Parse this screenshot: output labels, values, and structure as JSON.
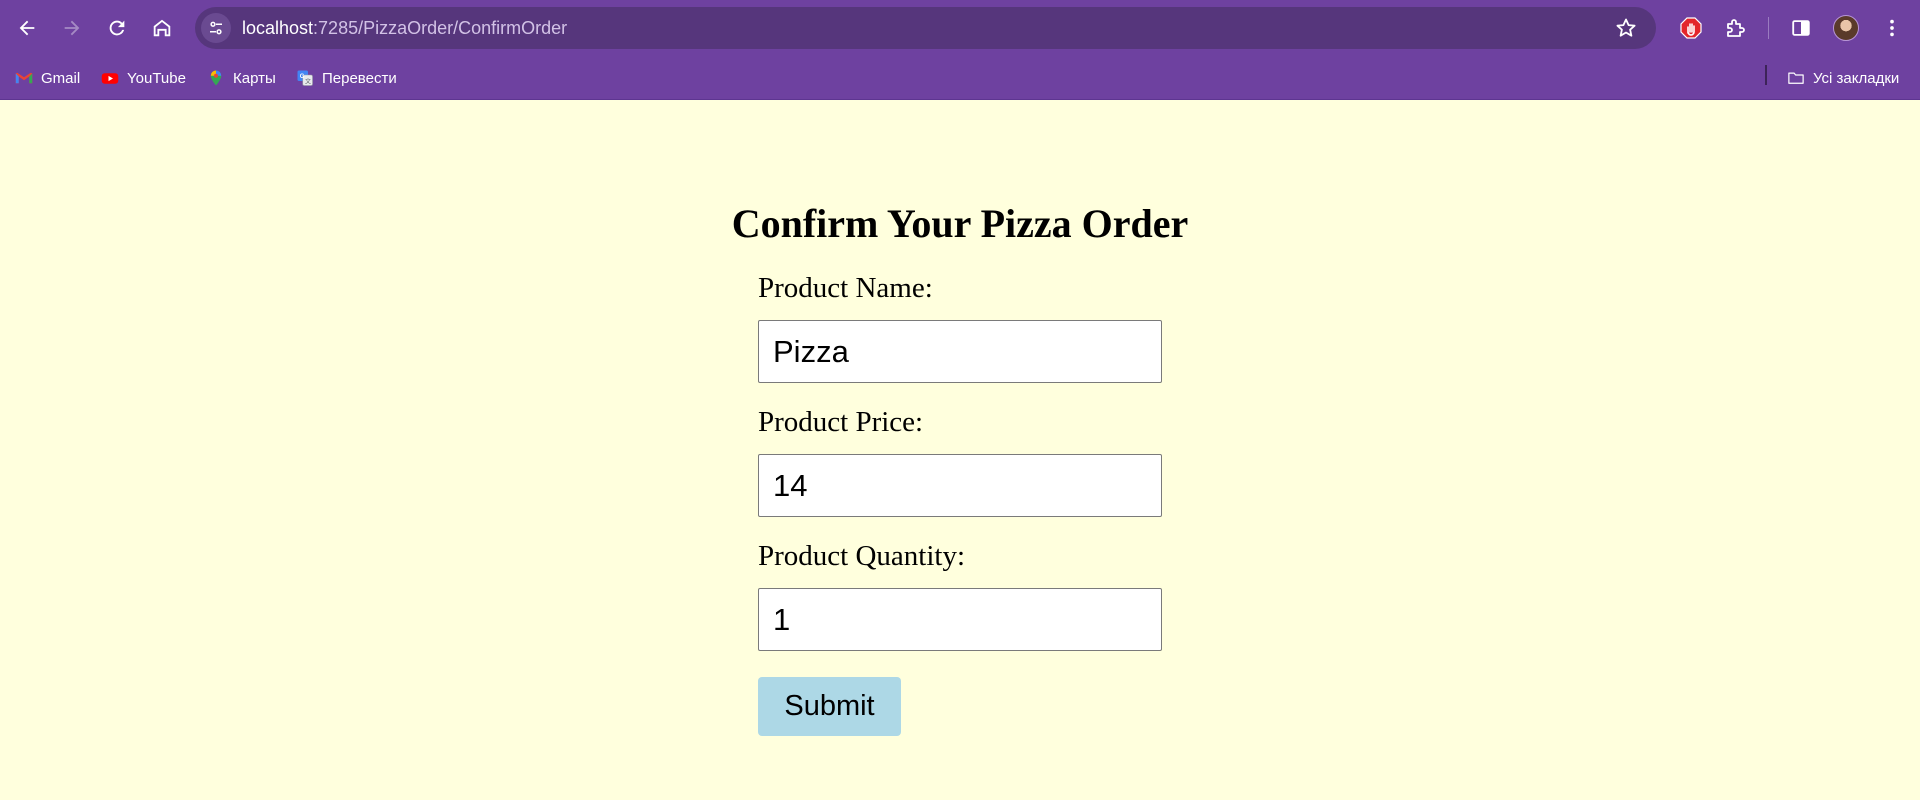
{
  "browser": {
    "url_host": "localhost",
    "url_path": ":7285/PizzaOrder/ConfirmOrder",
    "icons": {
      "back": "arrow-left-icon",
      "forward": "arrow-right-icon",
      "reload": "reload-icon",
      "home": "home-icon",
      "site_info": "tune-icon",
      "bookmark_star": "star-icon",
      "extension_adblock": "hand-stop-icon",
      "extensions": "puzzle-icon",
      "side_panel": "side-panel-icon",
      "menu": "kebab-menu-icon"
    },
    "colors": {
      "chrome": "#6e41a0",
      "omnibox": "#56367c"
    }
  },
  "bookmarks": {
    "items": [
      {
        "label": "Gmail",
        "icon": "gmail-icon"
      },
      {
        "label": "YouTube",
        "icon": "youtube-icon"
      },
      {
        "label": "Карты",
        "icon": "maps-icon"
      },
      {
        "label": "Перевести",
        "icon": "translate-icon"
      }
    ],
    "all_bookmarks": {
      "label": "Усі закладки",
      "icon": "folder-icon"
    }
  },
  "page": {
    "background": "#ffffdd",
    "title": "Confirm Your Pizza Order",
    "form": {
      "product_name": {
        "label": "Product Name:",
        "value": "Pizza"
      },
      "product_price": {
        "label": "Product Price:",
        "value": "14"
      },
      "product_quantity": {
        "label": "Product Quantity:",
        "value": "1"
      },
      "submit_label": "Submit",
      "submit_color": "#add8e6"
    }
  }
}
